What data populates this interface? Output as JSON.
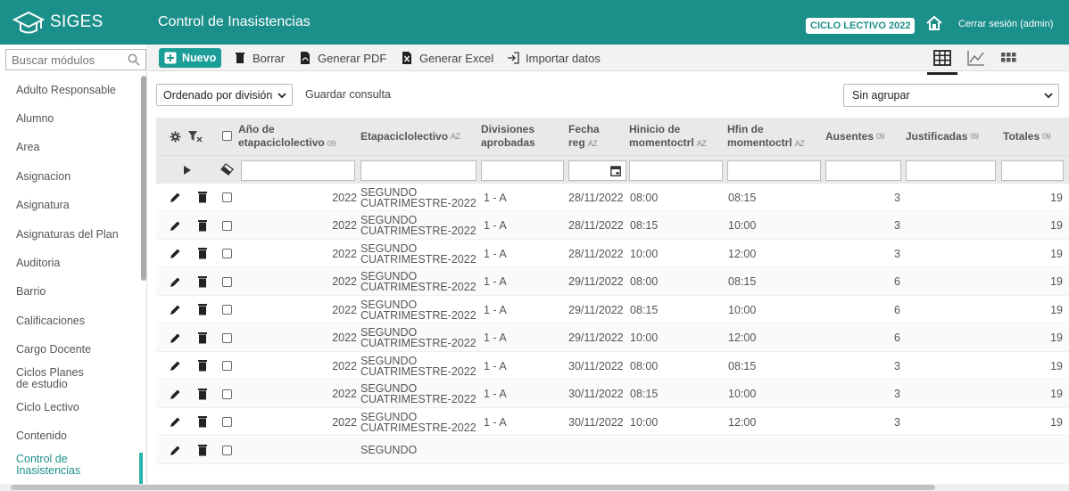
{
  "app": {
    "logo_text": "SIGES",
    "page_title": "Control de Inasistencias",
    "ciclo_badge": "CICLO LECTIVO 2022",
    "logout_label": "Cerrar sesión (admin)",
    "accent_color": "#1b8f8a"
  },
  "sidebar": {
    "search_placeholder": "Buscar módulos",
    "items": [
      {
        "label": "Adulto Responsable"
      },
      {
        "label": "Alumno"
      },
      {
        "label": "Area"
      },
      {
        "label": "Asignacion"
      },
      {
        "label": "Asignatura"
      },
      {
        "label": "Asignaturas del Plan"
      },
      {
        "label": "Auditoria"
      },
      {
        "label": "Barrio"
      },
      {
        "label": "Calificaciones"
      },
      {
        "label": "Cargo Docente"
      },
      {
        "label": "Ciclos Planes de estudio"
      },
      {
        "label": "Ciclo Lectivo"
      },
      {
        "label": "Contenido"
      },
      {
        "label": "Control de Inasistencias"
      }
    ]
  },
  "toolbar": {
    "nuevo": "Nuevo",
    "borrar": "Borrar",
    "pdf": "Generar PDF",
    "excel": "Generar Excel",
    "importar": "Importar datos"
  },
  "query": {
    "sort_value": "Ordenado por división",
    "save_query": "Guardar consulta",
    "group_value": "Sin agrupar"
  },
  "grid": {
    "headers": {
      "anio": [
        "Año de",
        "etapaciclolectivo"
      ],
      "etapa": "Etapaciclolectivo",
      "divisiones": [
        "Divisiones",
        "aprobadas"
      ],
      "fecha": [
        "Fecha",
        "reg"
      ],
      "hinicio": [
        "Hinicio de",
        "momentoctrl"
      ],
      "hfin": [
        "Hfin de",
        "momentoctrl"
      ],
      "ausentes": "Ausentes",
      "justificadas": "Justificadas",
      "totales": "Totales"
    },
    "sort_alpha": "AZ",
    "sort_num": "09",
    "rows": [
      {
        "anio": "2022",
        "etapa1": "SEGUNDO",
        "etapa2": "CUATRIMESTRE-2022",
        "div": "1 - A",
        "fecha": "28/11/2022",
        "hinicio": "08:00",
        "hfin": "08:15",
        "ausentes": "3",
        "justificadas": "",
        "totales": "19"
      },
      {
        "anio": "2022",
        "etapa1": "SEGUNDO",
        "etapa2": "CUATRIMESTRE-2022",
        "div": "1 - A",
        "fecha": "28/11/2022",
        "hinicio": "08:15",
        "hfin": "10:00",
        "ausentes": "3",
        "justificadas": "",
        "totales": "19"
      },
      {
        "anio": "2022",
        "etapa1": "SEGUNDO",
        "etapa2": "CUATRIMESTRE-2022",
        "div": "1 - A",
        "fecha": "28/11/2022",
        "hinicio": "10:00",
        "hfin": "12:00",
        "ausentes": "3",
        "justificadas": "",
        "totales": "19"
      },
      {
        "anio": "2022",
        "etapa1": "SEGUNDO",
        "etapa2": "CUATRIMESTRE-2022",
        "div": "1 - A",
        "fecha": "29/11/2022",
        "hinicio": "08:00",
        "hfin": "08:15",
        "ausentes": "6",
        "justificadas": "",
        "totales": "19"
      },
      {
        "anio": "2022",
        "etapa1": "SEGUNDO",
        "etapa2": "CUATRIMESTRE-2022",
        "div": "1 - A",
        "fecha": "29/11/2022",
        "hinicio": "08:15",
        "hfin": "10:00",
        "ausentes": "6",
        "justificadas": "",
        "totales": "19"
      },
      {
        "anio": "2022",
        "etapa1": "SEGUNDO",
        "etapa2": "CUATRIMESTRE-2022",
        "div": "1 - A",
        "fecha": "29/11/2022",
        "hinicio": "10:00",
        "hfin": "12:00",
        "ausentes": "6",
        "justificadas": "",
        "totales": "19"
      },
      {
        "anio": "2022",
        "etapa1": "SEGUNDO",
        "etapa2": "CUATRIMESTRE-2022",
        "div": "1 - A",
        "fecha": "30/11/2022",
        "hinicio": "08:00",
        "hfin": "08:15",
        "ausentes": "3",
        "justificadas": "",
        "totales": "19"
      },
      {
        "anio": "2022",
        "etapa1": "SEGUNDO",
        "etapa2": "CUATRIMESTRE-2022",
        "div": "1 - A",
        "fecha": "30/11/2022",
        "hinicio": "08:15",
        "hfin": "10:00",
        "ausentes": "3",
        "justificadas": "",
        "totales": "19"
      },
      {
        "anio": "2022",
        "etapa1": "SEGUNDO",
        "etapa2": "CUATRIMESTRE-2022",
        "div": "1 - A",
        "fecha": "30/11/2022",
        "hinicio": "10:00",
        "hfin": "12:00",
        "ausentes": "3",
        "justificadas": "",
        "totales": "19"
      },
      {
        "anio": "",
        "etapa1": "SEGUNDO",
        "etapa2": "",
        "div": "",
        "fecha": "",
        "hinicio": "",
        "hfin": "",
        "ausentes": "",
        "justificadas": "",
        "totales": ""
      }
    ]
  }
}
